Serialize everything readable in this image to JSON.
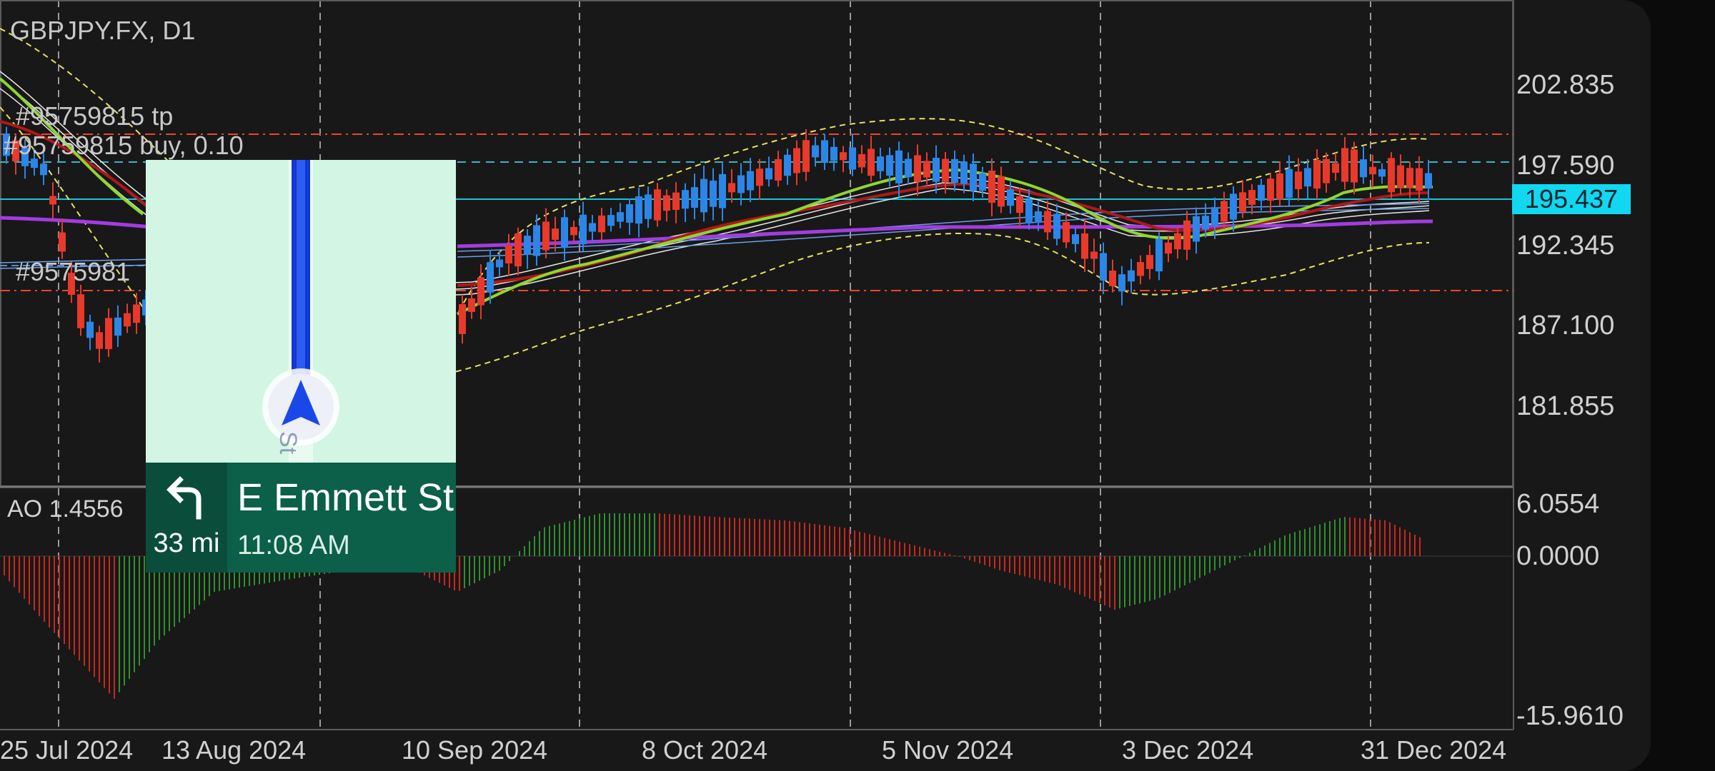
{
  "chart": {
    "symbol": "GBPJPY.FX, D1",
    "order_tp_label": "#95759815 tp",
    "order_buy_label": "#95759815 buy, 0.10",
    "order_line_label": "#9575981",
    "price_ticks": [
      "202.835",
      "197.590",
      "192.345",
      "187.100",
      "181.855"
    ],
    "current_price": "195.437",
    "ao_label": "AO 1.4556",
    "ao_ticks": [
      "6.0554",
      "0.0000",
      "-15.9610"
    ],
    "date_ticks": [
      "25 Jul 2024",
      "13 Aug 2024",
      "10 Sep 2024",
      "8 Oct 2024",
      "5 Nov 2024",
      "3 Dec 2024",
      "31 Dec 2024"
    ],
    "colors": {
      "bull": "#2b86e8",
      "bear": "#e8392a",
      "ma_fast": "#8fd630",
      "ma_mid": "#b01818",
      "ma_slow": "#a23ce0",
      "bands": "#e8e060",
      "ao_up": "#2f8f2f",
      "ao_down": "#c8281e",
      "price_line": "#12c8d8",
      "order_line": "#e8482a"
    }
  },
  "navigation": {
    "street": "E Emmett St",
    "distance": "33 mi",
    "eta": "11:08 AM",
    "turn_icon": "turn-left-icon",
    "marker_icon": "navigation-arrow-icon"
  }
}
